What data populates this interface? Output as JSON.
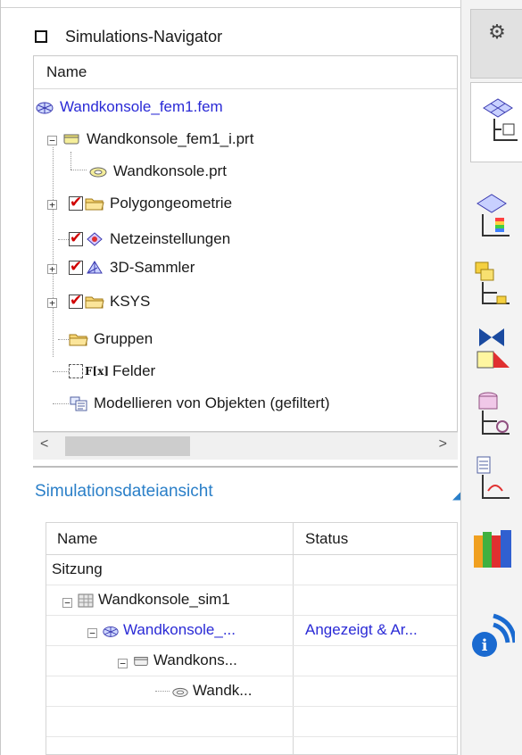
{
  "navigator": {
    "title": "Simulations-Navigator",
    "column_name": "Name",
    "tree": [
      {
        "label": "Wandkonsole_fem1.fem",
        "icon": "fem-mesh-icon",
        "link": true
      },
      {
        "label": "Wandkonsole_fem1_i.prt",
        "icon": "part-icon"
      },
      {
        "label": "Wandkonsole.prt",
        "icon": "part-ref-icon"
      },
      {
        "label": "Polygongeometrie",
        "icon": "folder-icon",
        "checked": true
      },
      {
        "label": "Netzeinstellungen",
        "icon": "mesh-settings-icon",
        "checked": true
      },
      {
        "label": "3D-Sammler",
        "icon": "collector-3d-icon",
        "checked": true
      },
      {
        "label": "KSYS",
        "icon": "folder-icon",
        "checked": true
      },
      {
        "label": "Gruppen",
        "icon": "folder-icon"
      },
      {
        "label": "Felder",
        "icon": "fields-icon",
        "prefix": "F[x]"
      },
      {
        "label": "Modellieren von Objekten (gefiltert)",
        "icon": "modeling-objects-icon"
      }
    ]
  },
  "sim_file_view": {
    "title": "Simulationsdateiansicht",
    "columns": [
      "Name",
      "Status"
    ],
    "rows": [
      {
        "name": "Sitzung",
        "status": ""
      },
      {
        "name": "Wandkonsole_sim1",
        "status": ""
      },
      {
        "name": "Wandkonsole_...",
        "status": "Angezeigt & Ar...",
        "link": true
      },
      {
        "name": "Wandkons...",
        "status": ""
      },
      {
        "name": "Wandk...",
        "status": ""
      }
    ]
  },
  "colors": {
    "link": "#2a2ad6",
    "title_blue": "#2a7fc8",
    "check_red": "#d00000"
  },
  "resource_bar": [
    "gear-icon",
    "simulation-navigator-tab-icon",
    "post-processing-navigator-icon",
    "assembly-fem-icon",
    "constraint-icon",
    "roles-icon",
    "history-icon",
    "library-icon",
    "info-icon"
  ]
}
